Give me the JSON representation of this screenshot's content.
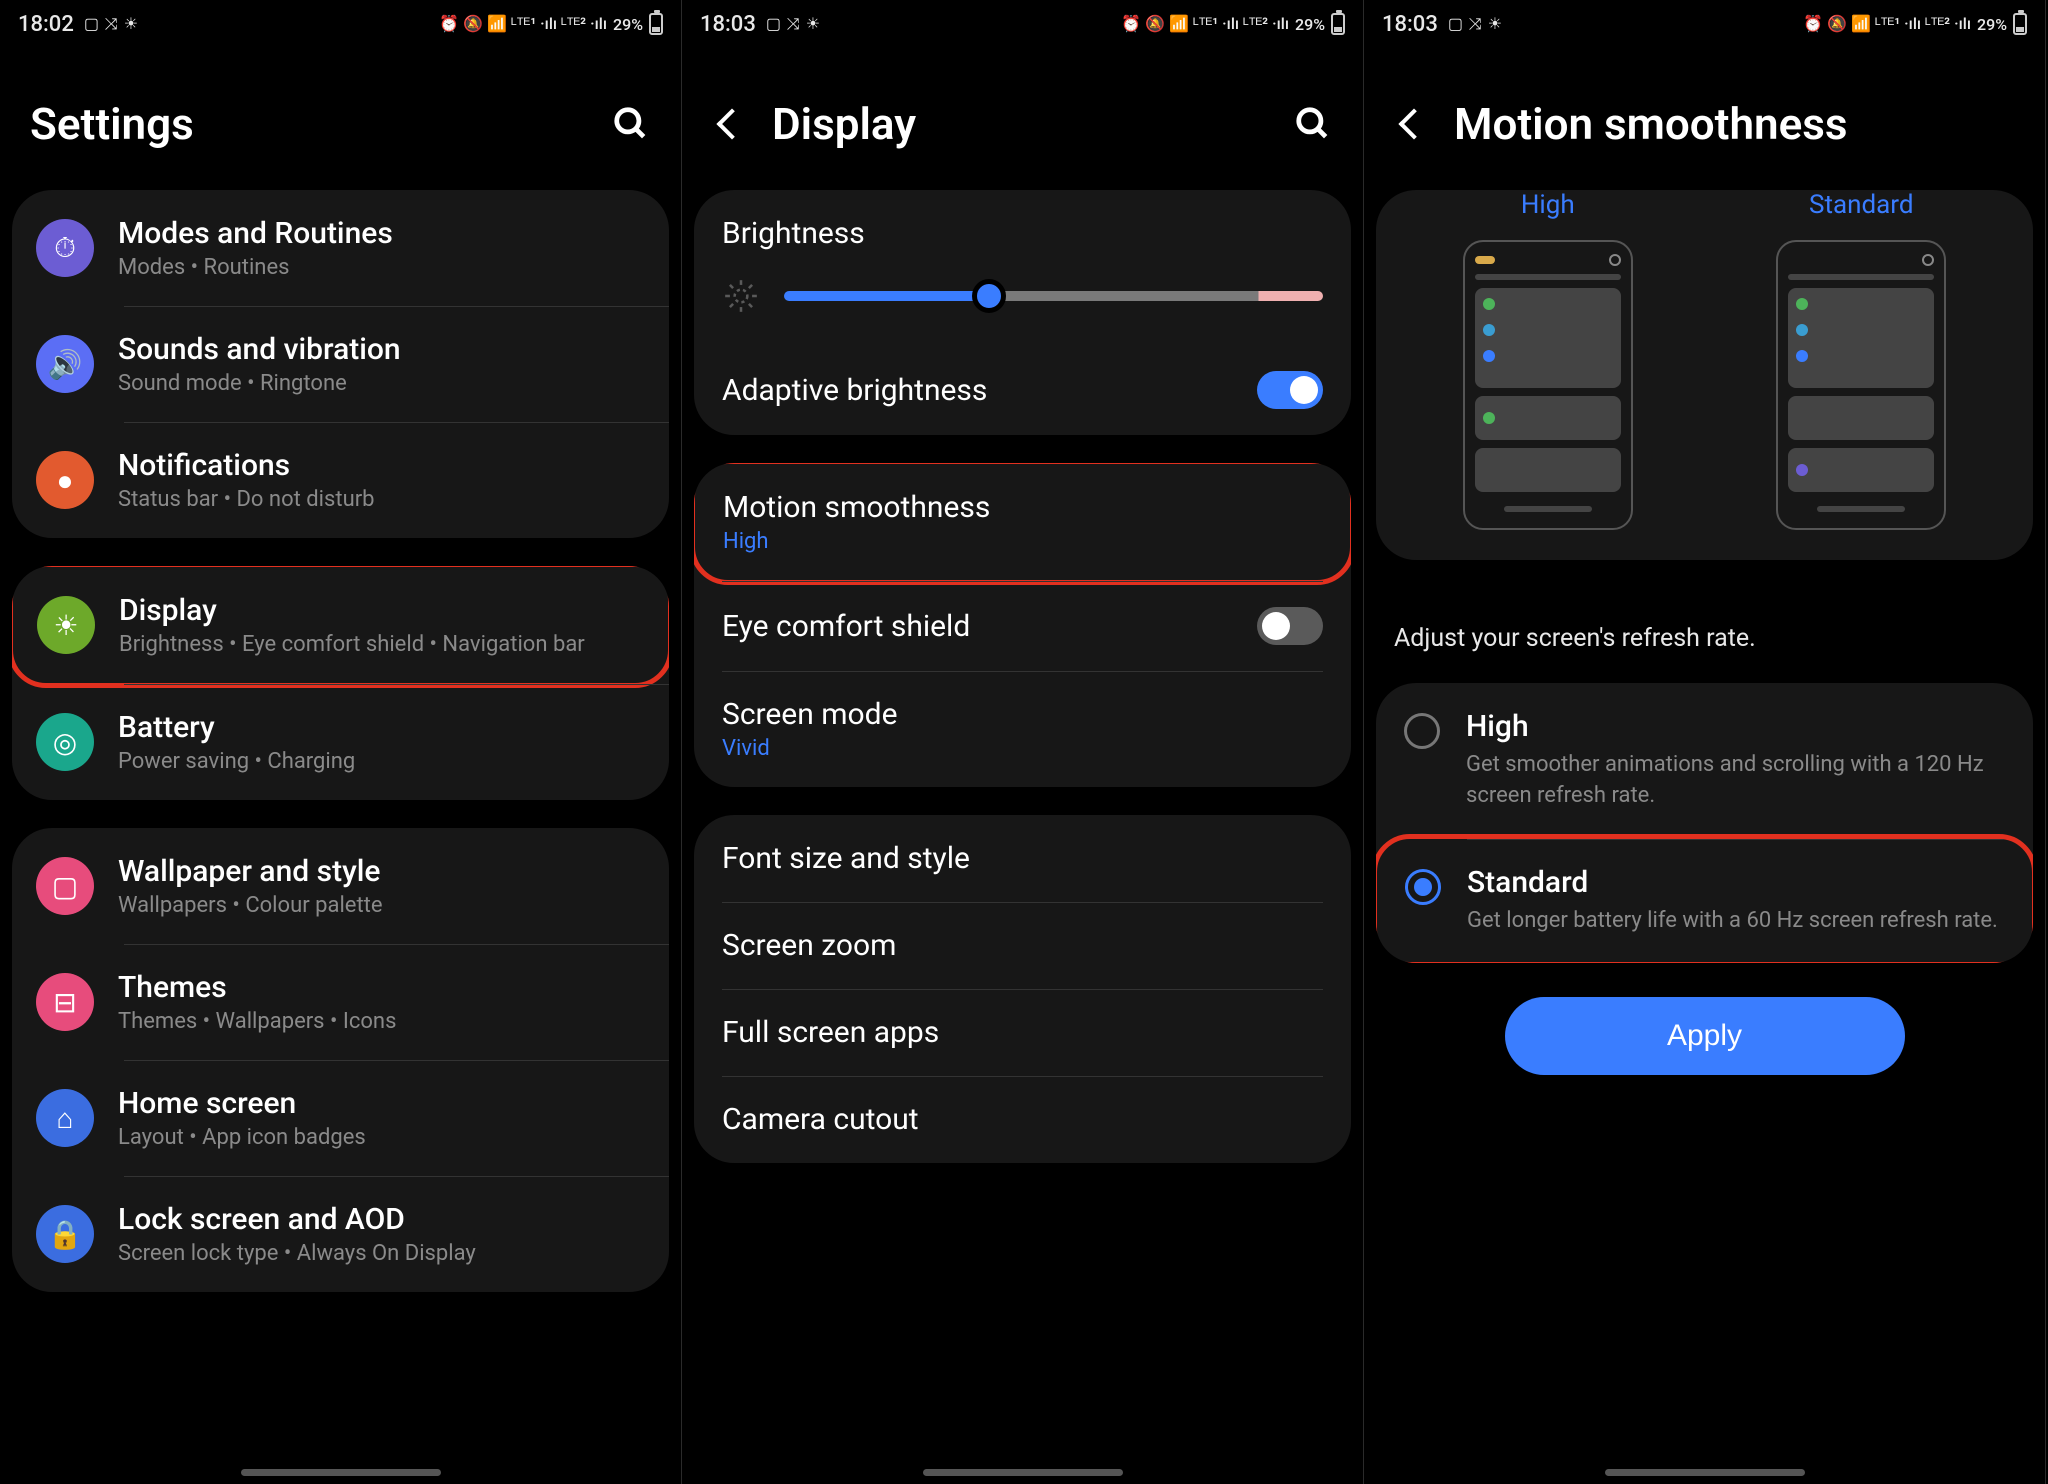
{
  "status": {
    "time1": "18:02",
    "time2": "18:03",
    "time3": "18:03",
    "left_icons": "▢ ⤨ ☀",
    "right_icons": "⏰ 🔕 📶 ᴸᵀᴱ¹ ·ılı ᴸᵀᴱ² ·ılı",
    "battery_pct": "29%"
  },
  "panel1": {
    "title": "Settings",
    "group1": [
      {
        "icon": "⏱",
        "bg": "#6c5dd3",
        "title": "Modes and Routines",
        "sub": "Modes • Routines"
      },
      {
        "icon": "🔊",
        "bg": "#5b6ef5",
        "title": "Sounds and vibration",
        "sub": "Sound mode • Ringtone"
      },
      {
        "icon": "●",
        "bg": "#e25a2f",
        "title": "Notifications",
        "sub": "Status bar • Do not disturb"
      }
    ],
    "group2": [
      {
        "icon": "☀",
        "bg": "#6da92a",
        "title": "Display",
        "sub": "Brightness • Eye comfort shield • Navigation bar",
        "hl": true
      },
      {
        "icon": "◎",
        "bg": "#1aa78c",
        "title": "Battery",
        "sub": "Power saving • Charging"
      }
    ],
    "group3": [
      {
        "icon": "▢",
        "bg": "#e74c7c",
        "title": "Wallpaper and style",
        "sub": "Wallpapers • Colour palette"
      },
      {
        "icon": "⊟",
        "bg": "#e74c7c",
        "title": "Themes",
        "sub": "Themes • Wallpapers • Icons"
      },
      {
        "icon": "⌂",
        "bg": "#3b6de0",
        "title": "Home screen",
        "sub": "Layout • App icon badges"
      },
      {
        "icon": "🔒",
        "bg": "#3b6de0",
        "title": "Lock screen and AOD",
        "sub": "Screen lock type • Always On Display"
      }
    ]
  },
  "panel2": {
    "title": "Display",
    "brightness_label": "Brightness",
    "adaptive_label": "Adaptive brightness",
    "motion": {
      "title": "Motion smoothness",
      "value": "High",
      "hl": true
    },
    "eye_label": "Eye comfort shield",
    "screen_mode": {
      "title": "Screen mode",
      "value": "Vivid"
    },
    "group2": [
      "Font size and style",
      "Screen zoom",
      "Full screen apps",
      "Camera cutout"
    ]
  },
  "panel3": {
    "title": "Motion smoothness",
    "preview_high": "High",
    "preview_std": "Standard",
    "desc": "Adjust your screen's refresh rate.",
    "options": [
      {
        "title": "High",
        "sub": "Get smoother animations and scrolling with a 120 Hz screen refresh rate.",
        "selected": false,
        "hl": false
      },
      {
        "title": "Standard",
        "sub": "Get longer battery life with a 60 Hz screen refresh rate.",
        "selected": true,
        "hl": true
      }
    ],
    "apply": "Apply"
  }
}
